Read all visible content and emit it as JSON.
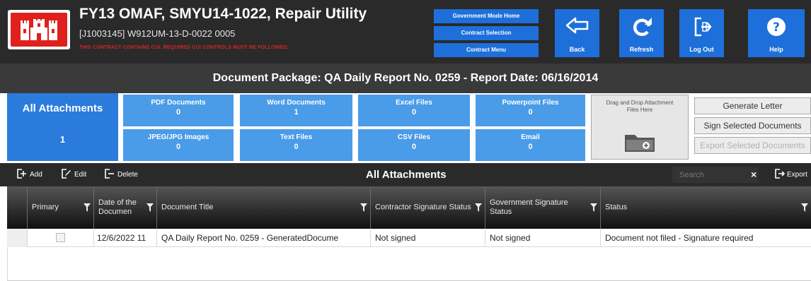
{
  "header": {
    "title": "FY13 OMAF, SMYU14-1022, Repair Utility",
    "subtitle": "[J1003145] W912UM-13-D-0022  0005",
    "warning": "THIS CONTRACT CONTAINS CUI. REQUIRED CUI CONTROLS MUST BE FOLLOWED.",
    "logo_icon": "castle-icon",
    "logo_color": "#e0201c",
    "gov_links": [
      "Government Mode Home",
      "Contract Selection",
      "Contract Menu"
    ],
    "buttons": [
      {
        "label": "Back",
        "icon": "back-arrow-icon"
      },
      {
        "label": "Refresh",
        "icon": "refresh-icon"
      },
      {
        "label": "Log Out",
        "icon": "logout-icon"
      },
      {
        "label": "Help",
        "icon": "help-icon"
      }
    ],
    "accent_color": "#1e6fd9"
  },
  "package": {
    "title": "Document Package: QA Daily Report No. 0259 - Report Date: 06/16/2014"
  },
  "categories": {
    "all": {
      "label": "All Attachments",
      "count": "1"
    },
    "tiles": [
      {
        "label": "PDF Documents",
        "count": "0"
      },
      {
        "label": "Word Documents",
        "count": "1"
      },
      {
        "label": "Excel Files",
        "count": "0"
      },
      {
        "label": "Powerpoint Files",
        "count": "0"
      },
      {
        "label": "JPEG/JPG Images",
        "count": "0"
      },
      {
        "label": "Text Files",
        "count": "0"
      },
      {
        "label": "CSV Files",
        "count": "0"
      },
      {
        "label": "Email",
        "count": "0"
      }
    ],
    "dropzone": {
      "label": "Drag and Drop Attachment Files Here",
      "icon": "folder-icon"
    },
    "actions": [
      "Generate Letter",
      "Sign Selected Documents",
      "Export Selected Documents"
    ]
  },
  "toolbar": {
    "add_label": "Add",
    "edit_label": "Edit",
    "delete_label": "Delete",
    "title": "All Attachments",
    "search_placeholder": "Search",
    "clear_label": "×",
    "export_label": "Export"
  },
  "table": {
    "columns": [
      "Primary",
      "Date of the Documen",
      "Document Title",
      "Contractor Signature Status",
      "Government Signature Status",
      "Status"
    ],
    "rows": [
      {
        "primary": false,
        "date": "12/6/2022 11",
        "title": "QA Daily Report No. 0259 - GeneratedDocume",
        "contractor_sig": "Not signed",
        "gov_sig": "Not signed",
        "status": "Document not filed - Signature required"
      }
    ]
  }
}
